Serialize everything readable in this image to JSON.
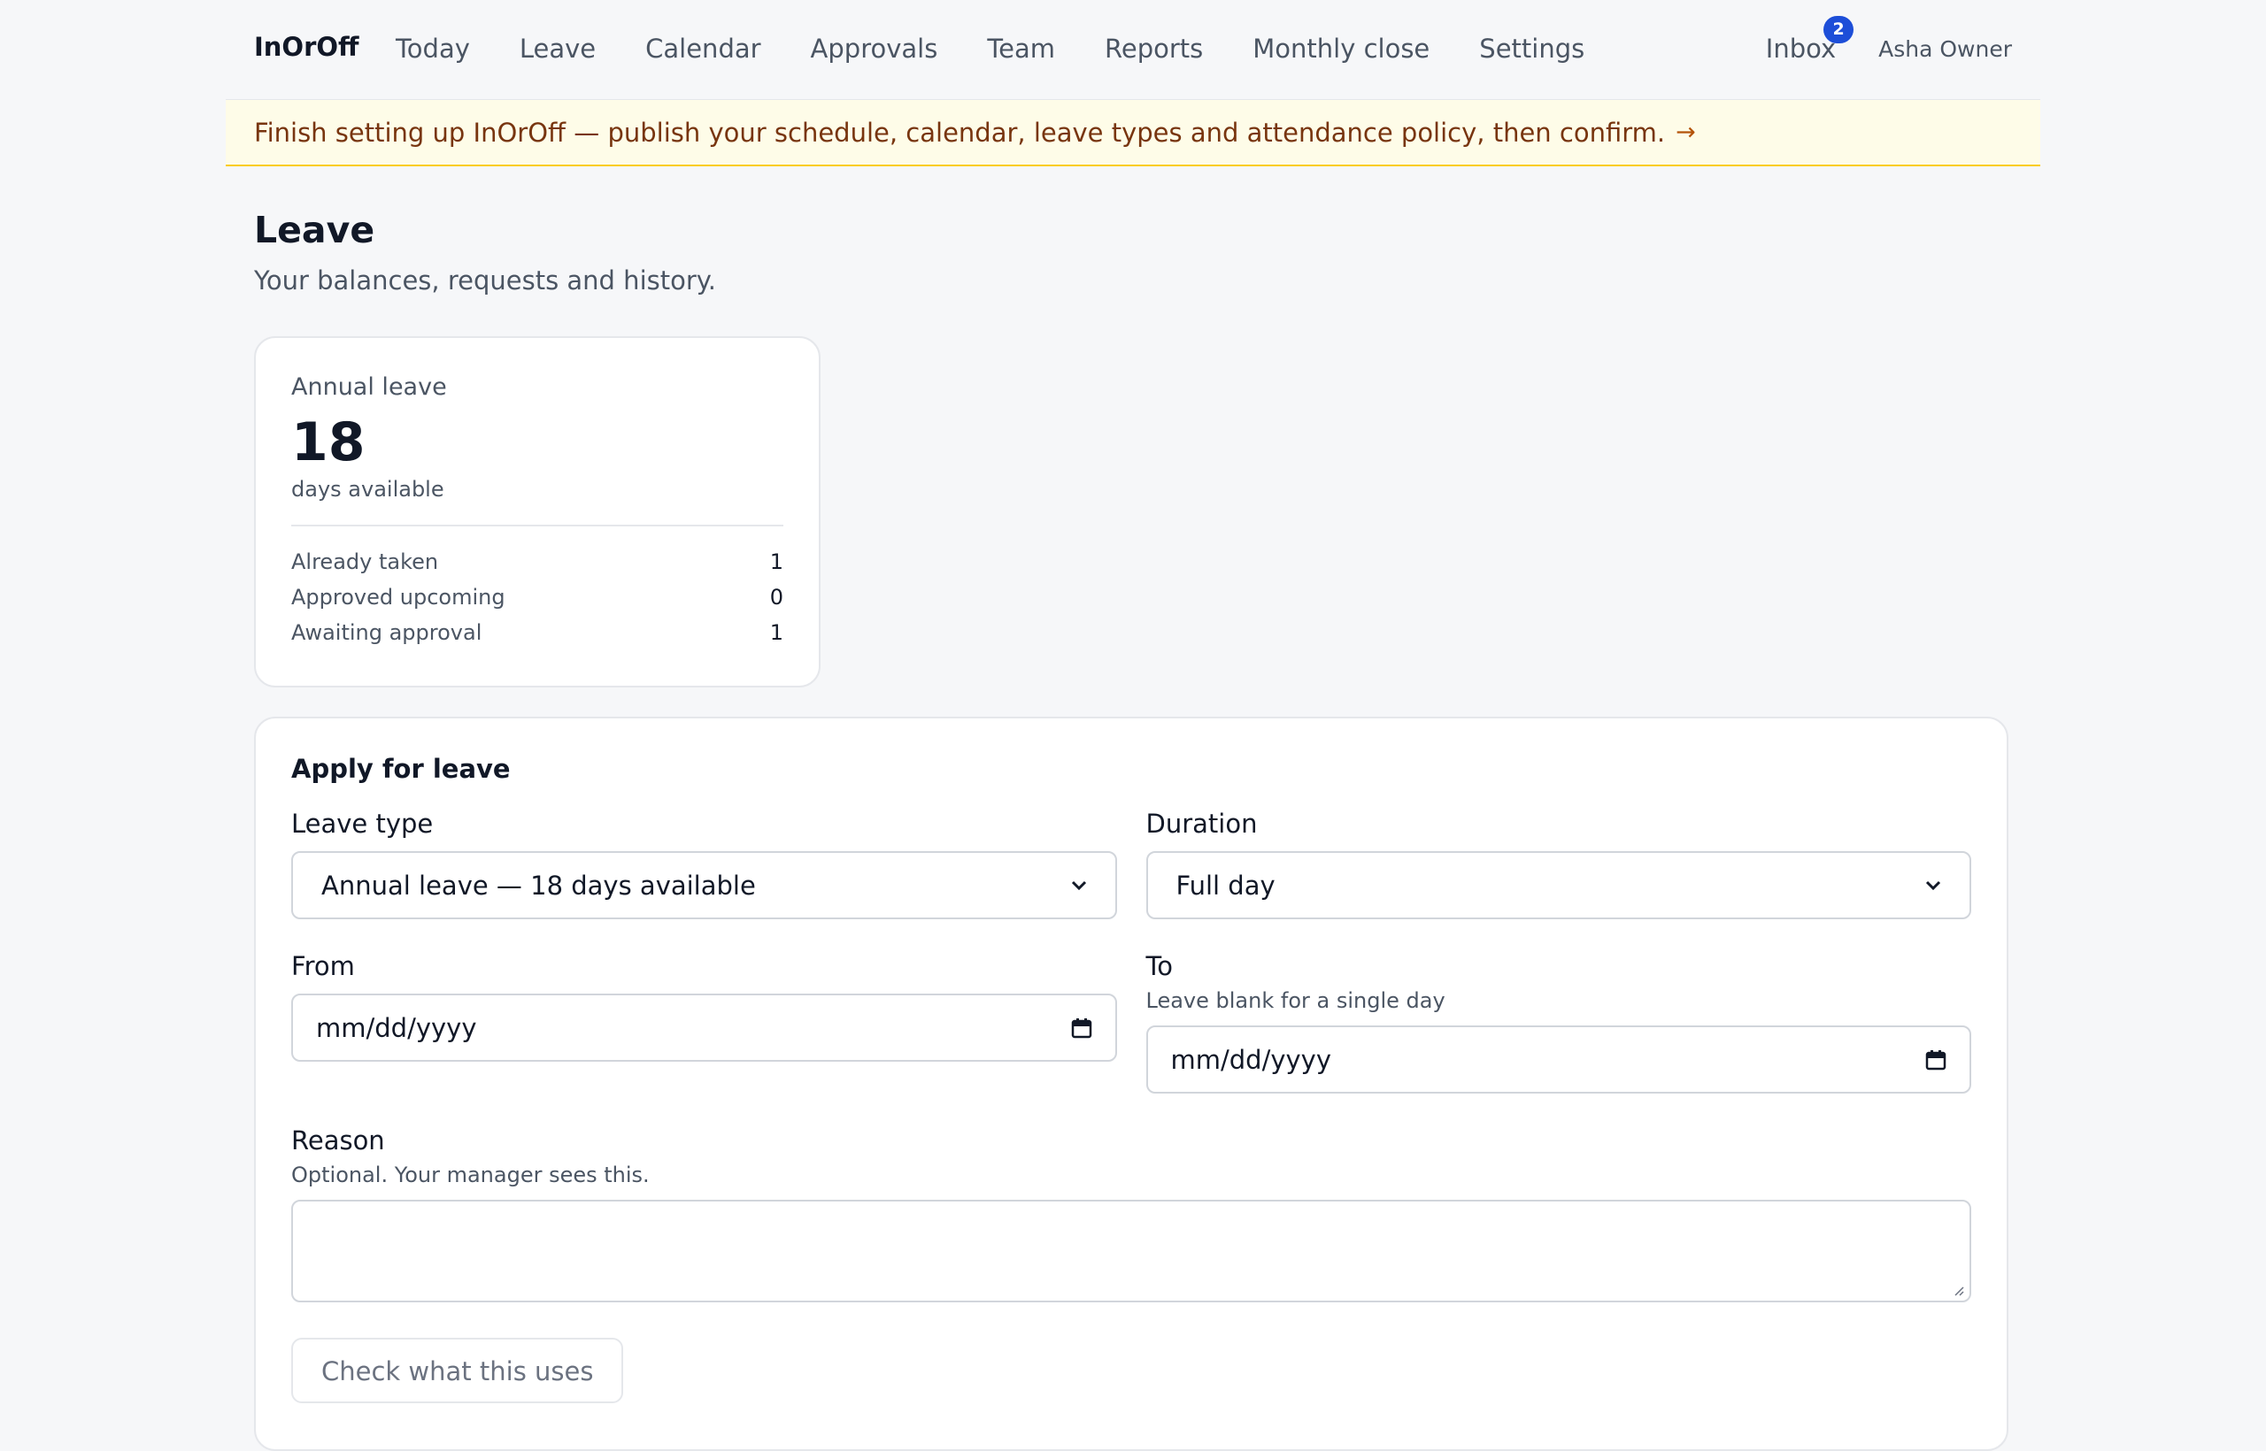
{
  "nav": {
    "brand": "InOrOff",
    "links": [
      "Today",
      "Leave",
      "Calendar",
      "Approvals",
      "Team",
      "Reports",
      "Monthly close",
      "Settings"
    ],
    "inbox_label": "Inbox",
    "inbox_count": "2",
    "user_name": "Asha Owner"
  },
  "banner": {
    "text": "Finish setting up InOrOff — publish your schedule, calendar, leave types and attendance policy, then confirm.",
    "arrow": "→"
  },
  "page": {
    "title": "Leave",
    "subtitle": "Your balances, requests and history."
  },
  "balance": {
    "name": "Annual leave",
    "available": "18",
    "unit": "days available",
    "stats": [
      {
        "label": "Already taken",
        "value": "1"
      },
      {
        "label": "Approved upcoming",
        "value": "0"
      },
      {
        "label": "Awaiting approval",
        "value": "1"
      }
    ]
  },
  "form": {
    "title": "Apply for leave",
    "leave_type_label": "Leave type",
    "leave_type_value": "Annual leave — 18 days available",
    "duration_label": "Duration",
    "duration_value": "Full day",
    "from_label": "From",
    "from_placeholder": "mm/dd/yyyy",
    "to_label": "To",
    "to_hint": "Leave blank for a single day",
    "to_placeholder": "mm/dd/yyyy",
    "reason_label": "Reason",
    "reason_hint": "Optional. Your manager sees this.",
    "reason_value": "",
    "check_button": "Check what this uses"
  },
  "icons": {
    "select_chevron": "chevron-down-icon",
    "date_picker": "calendar-icon",
    "resize": "resize-grip-icon"
  },
  "colors": {
    "accent": "#1d4ed8",
    "banner_bg": "#fefce8",
    "banner_border": "#facc15",
    "banner_text": "#78350f"
  }
}
